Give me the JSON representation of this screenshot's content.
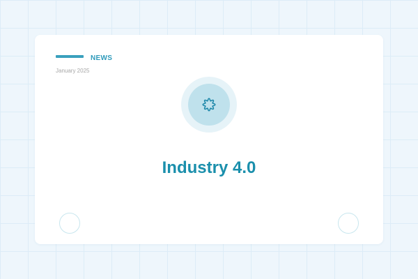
{
  "card": {
    "kicker": "NEWS",
    "date": "January 2025",
    "headline": "Industry 4.0"
  },
  "emblem": {
    "icon": "cog-icon"
  },
  "navigation": {
    "previous_icon": "circle-outline-icon",
    "next_icon": "circle-outline-icon"
  },
  "colors": {
    "background": "#eef6fc",
    "accent": "#3aa0bd",
    "headline": "#1a8fac",
    "emblem_outer": "#e6f3f8",
    "emblem_inner": "#bfe1ec"
  }
}
